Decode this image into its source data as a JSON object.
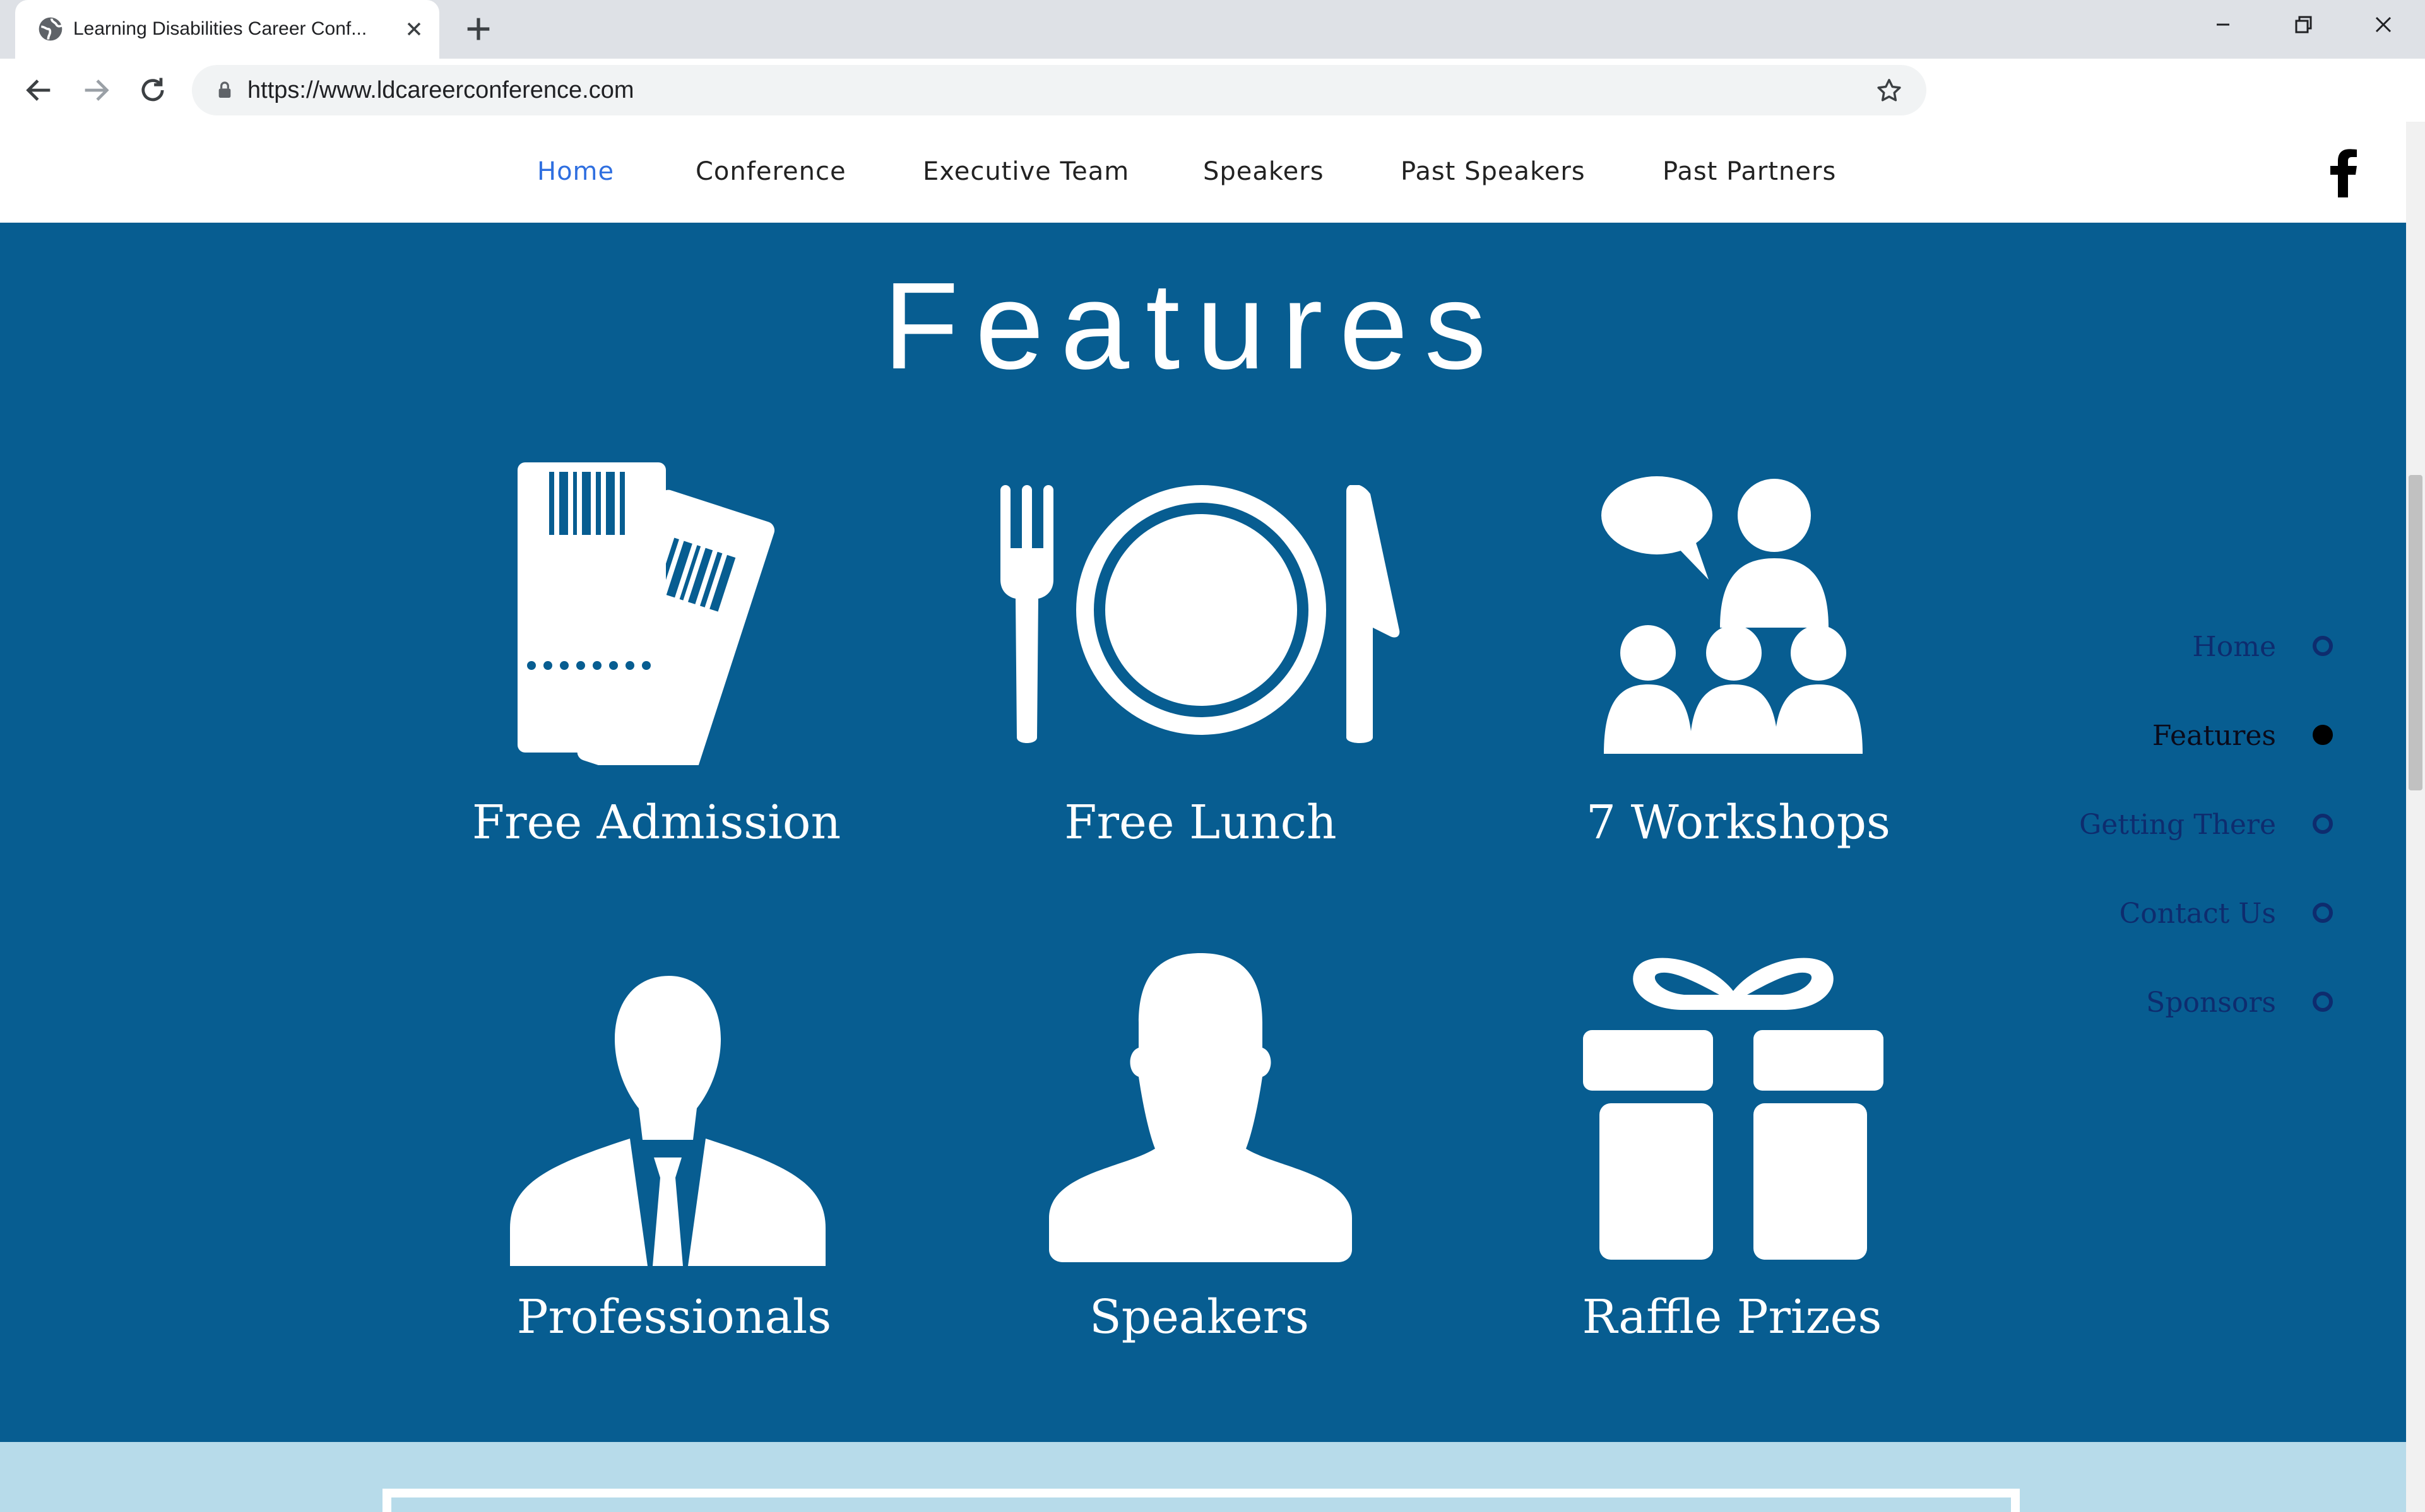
{
  "browser": {
    "tab_title": "Learning Disabilities Career Conf...",
    "url": "https://www.ldcareerconference.com"
  },
  "site_nav": {
    "items": [
      "Home",
      "Conference",
      "Executive Team",
      "Speakers",
      "Past Speakers",
      "Past Partners"
    ],
    "active": "Home"
  },
  "features": {
    "title": "Features",
    "items": [
      {
        "label": "Free Admission",
        "icon": "tickets-icon"
      },
      {
        "label": "Free Lunch",
        "icon": "plate-fork-knife-icon"
      },
      {
        "label": "7 Workshops",
        "icon": "workshop-audience-icon"
      },
      {
        "label": "Professionals",
        "icon": "businessman-icon"
      },
      {
        "label": "Speakers",
        "icon": "person-silhouette-icon"
      },
      {
        "label": "Raffle Prizes",
        "icon": "gift-icon"
      }
    ]
  },
  "side_nav": {
    "items": [
      "Home",
      "Features",
      "Getting There",
      "Contact Us",
      "Sponsors"
    ],
    "active": "Features"
  },
  "colors": {
    "section_bg": "#075d91",
    "nav_active": "#2f6fe0",
    "next_section_bg": "#b7dbea"
  }
}
